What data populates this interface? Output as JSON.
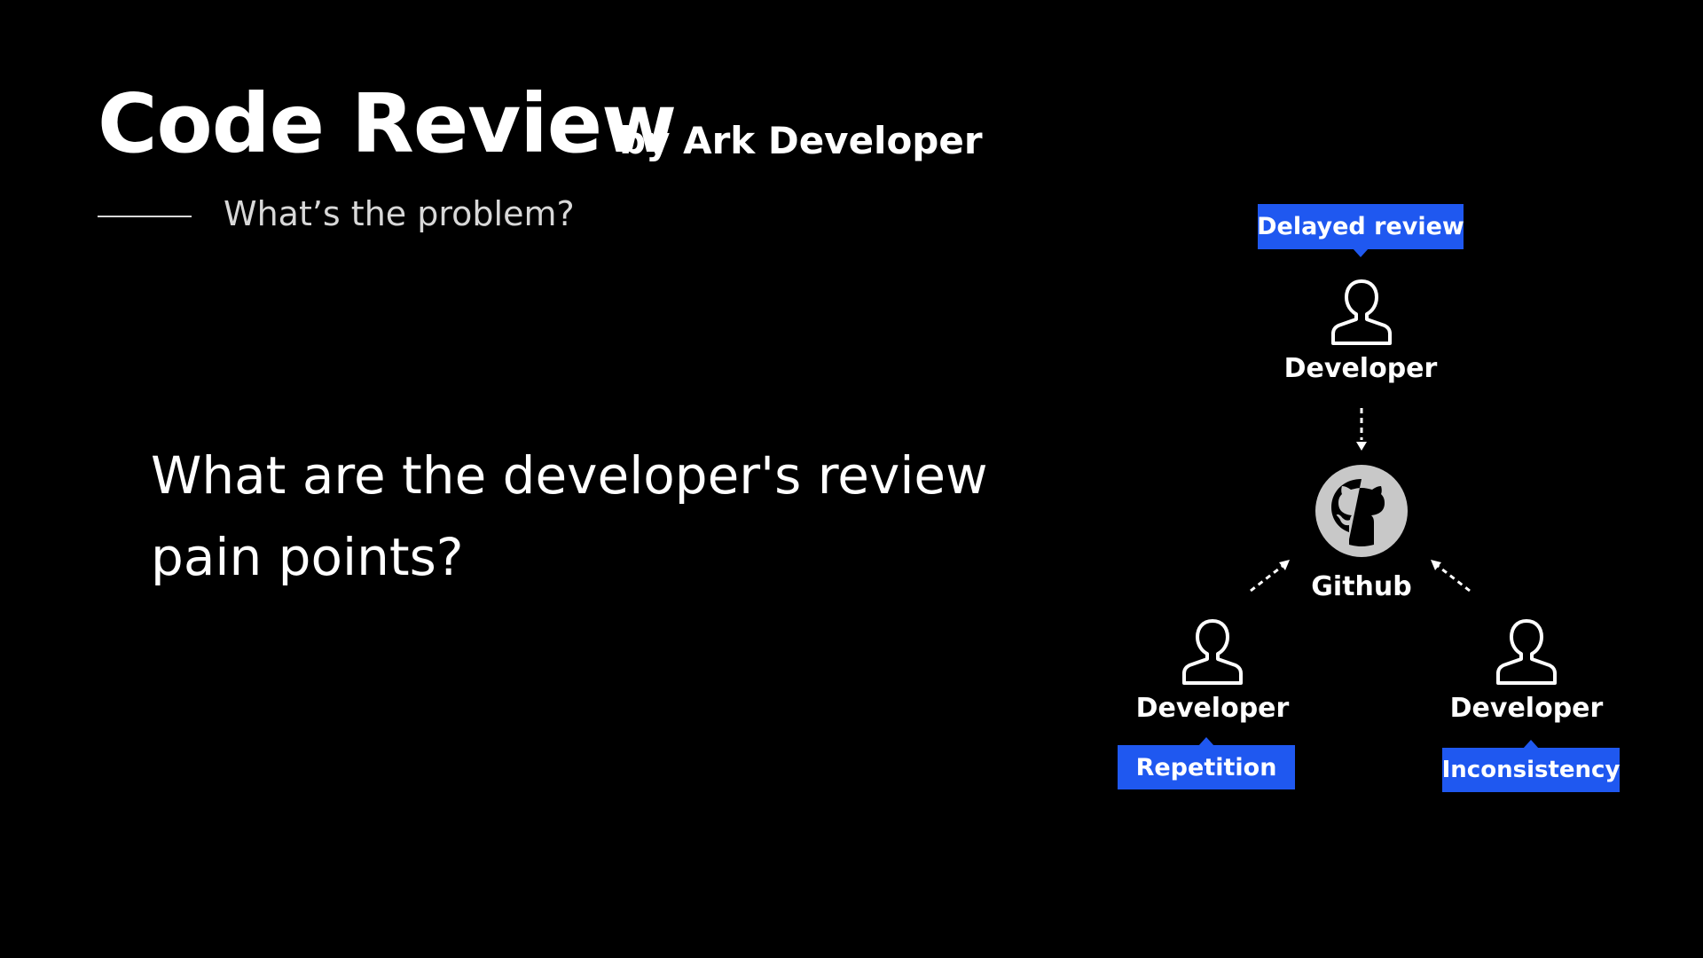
{
  "header": {
    "title": "Code Review",
    "byline": "by Ark Developer",
    "section": "What’s the problem?"
  },
  "main": {
    "question": "What are the developer's review pain points?"
  },
  "diagram": {
    "top_developer": {
      "label": "Developer",
      "tag": "Delayed review"
    },
    "hub": {
      "label": "Github",
      "icon": "github-octocat-icon"
    },
    "left_developer": {
      "label": "Developer",
      "tag": "Repetition"
    },
    "right_developer": {
      "label": "Developer",
      "tag": "Inconsistency"
    },
    "colors": {
      "background": "#000000",
      "tag_fill": "#1f58f0",
      "hub_circle": "#c8c8c8",
      "text": "#ffffff"
    }
  }
}
